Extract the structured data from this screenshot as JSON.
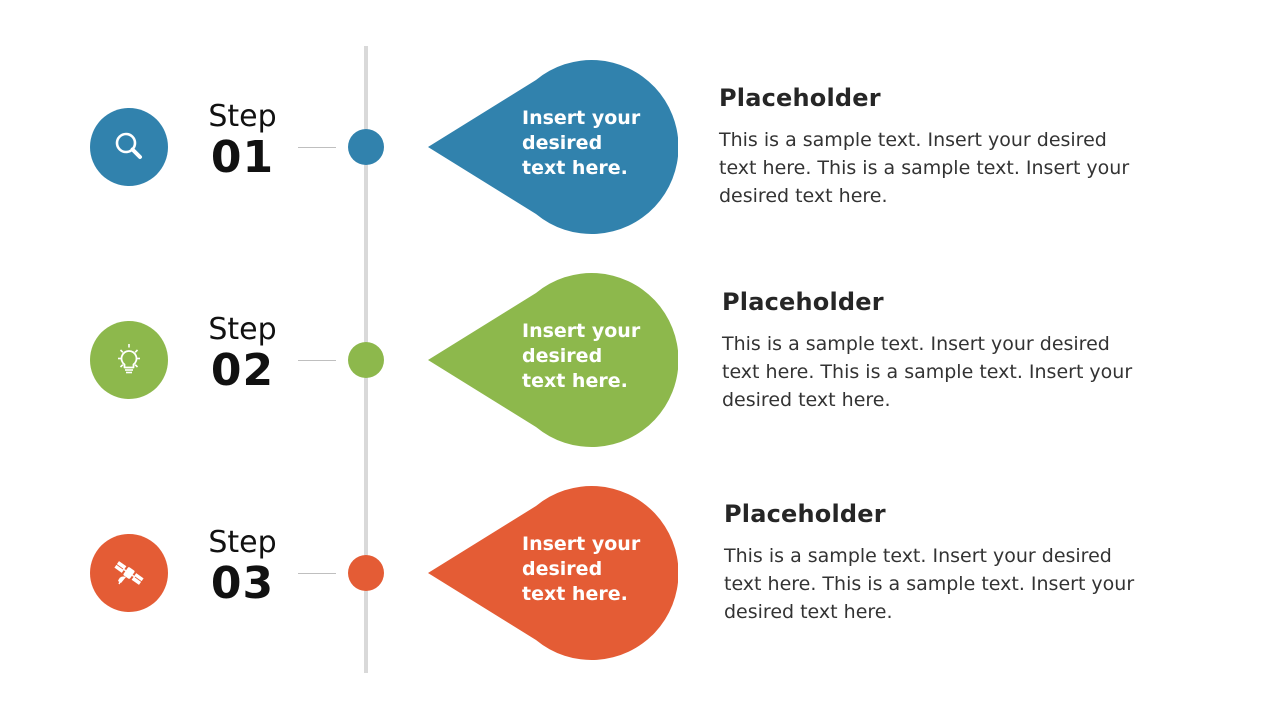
{
  "colors": {
    "timeline": "#d9d9d9",
    "connector": "#bfbfbf",
    "heading": "#262626",
    "body_text": "#333333"
  },
  "steps": [
    {
      "step_word": "Step",
      "step_number": "01",
      "icon": "magnifier-search-icon",
      "color": "#3182ad",
      "bubble_text": "Insert your desired text here.",
      "title": "Placeholder",
      "description": "This is a sample text. Insert your desired text here. This is a sample text. Insert your desired text here."
    },
    {
      "step_word": "Step",
      "step_number": "02",
      "icon": "lightbulb-icon",
      "color": "#8db84c",
      "bubble_text": "Insert your desired text here.",
      "title": "Placeholder",
      "description": "This is a sample text. Insert your desired text here. This is a sample text. Insert your desired text here."
    },
    {
      "step_word": "Step",
      "step_number": "03",
      "icon": "satellite-icon",
      "color": "#e45c35",
      "bubble_text": "Insert your desired text here.",
      "title": "Placeholder",
      "description": "This is a sample text. Insert your desired text here. This is a sample text. Insert your desired text here."
    }
  ]
}
